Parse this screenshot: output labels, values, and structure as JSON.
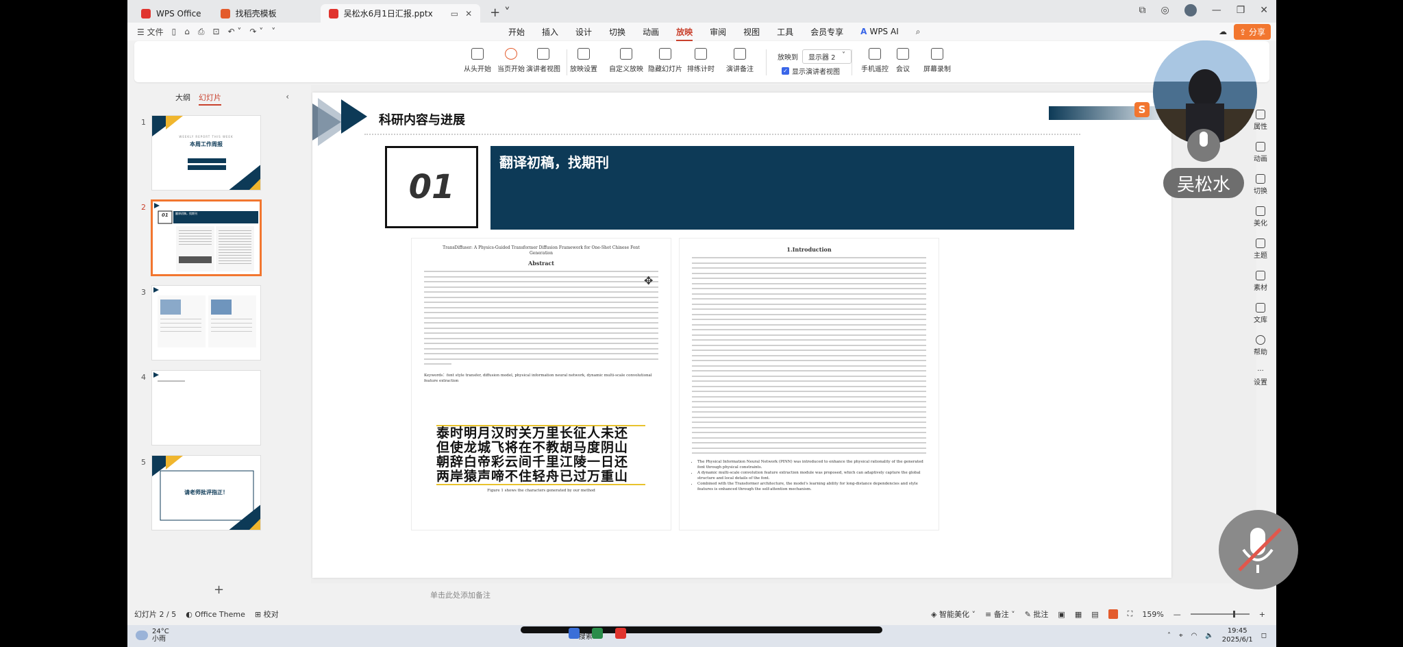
{
  "titlebar": {
    "tabs": [
      {
        "label": "WPS Office",
        "active": false
      },
      {
        "label": "找稻壳模板",
        "active": false
      },
      {
        "label": "吴松水6月1日汇报.pptx",
        "active": true
      }
    ],
    "window_controls": [
      "minimize",
      "maximize",
      "close"
    ]
  },
  "menubar": {
    "file": "文件",
    "items": [
      "开始",
      "插入",
      "设计",
      "切换",
      "动画",
      "放映",
      "审阅",
      "视图",
      "工具",
      "会员专享"
    ],
    "active": "放映",
    "wps_ai": "WPS AI",
    "share": "分享"
  },
  "ribbon": {
    "buttons": [
      {
        "label": "从头开始"
      },
      {
        "label": "当页开始"
      },
      {
        "label": "演讲者视图"
      },
      {
        "label": "放映设置"
      },
      {
        "label": "自定义放映"
      },
      {
        "label": "隐藏幻灯片"
      },
      {
        "label": "排练计时"
      },
      {
        "label": "演讲备注"
      },
      {
        "label": "手机遥控"
      },
      {
        "label": "会议"
      },
      {
        "label": "屏幕录制"
      }
    ],
    "play_to_label": "放映到",
    "play_to_value": "显示器 2",
    "show_presenter_view": "显示演讲者视图",
    "show_presenter_checked": true
  },
  "panel": {
    "tabs": [
      "大纲",
      "幻灯片"
    ],
    "active_tab": "幻灯片",
    "slides": [
      {
        "num": "1",
        "title": "本周工作周报",
        "sub": "WEEKLY REPORT THIS WEEK"
      },
      {
        "num": "2",
        "title": "翻译初稿，找期刊"
      },
      {
        "num": "3"
      },
      {
        "num": "4"
      },
      {
        "num": "5",
        "title": "请老师批评指正！"
      }
    ],
    "selected": 2
  },
  "slide": {
    "section_title": "科研内容与进展",
    "number_box": "01",
    "banner_title": "翻译初稿，找期刊",
    "paper_left": {
      "title": "TransDiffuser: A Physics-Guided Transformer Diffusion Framework for One-Shot Chinese Font Generation",
      "abstract_heading": "Abstract",
      "keywords": "Keywords：font style transfer, diffusion model, physical information neural network, dynamic multi-scale convolutional feature extraction",
      "chinese_lines": [
        "泰时明月汉时关万里长征人未还",
        "但使龙城飞将在不教胡马度阴山",
        "朝辞白帝彩云间千里江陵一日还",
        "两岸猿声啼不住轻舟已过万重山"
      ],
      "caption": "Figure 1 shows the characters generated by our method"
    },
    "paper_right": {
      "heading": "1.Introduction",
      "bullets": [
        "The Physical Information Neural Network (PINN) was introduced to enhance the physical rationality of the generated font through physical constraints.",
        "A dynamic multi-scale convolution feature extraction module was proposed, which can adaptively capture the global structure and local details of the font.",
        "Combined with the Transformer architecture, the model's learning ability for long-distance dependencies and style features is enhanced through the self-attention mechanism."
      ]
    }
  },
  "notes_placeholder": "单击此处添加备注",
  "statusbar": {
    "slide_counter": "幻灯片 2 / 5",
    "theme": "Office Theme",
    "proofread": "校对",
    "smart_beautify": "智能美化",
    "notes": "备注",
    "comments": "批注",
    "zoom": "159%"
  },
  "rightbar": [
    "属性",
    "动画",
    "切换",
    "美化",
    "主题",
    "素材",
    "文库",
    "帮助",
    "设置"
  ],
  "overlay": {
    "presenter_name": "吴松水"
  },
  "taskbar": {
    "temperature": "24°C",
    "weather": "小雨",
    "search": "搜索",
    "time": "19:45",
    "date": "2025/6/1"
  },
  "colors": {
    "accent": "#c9412d",
    "navy": "#0d3a57",
    "orange": "#f2762f"
  }
}
